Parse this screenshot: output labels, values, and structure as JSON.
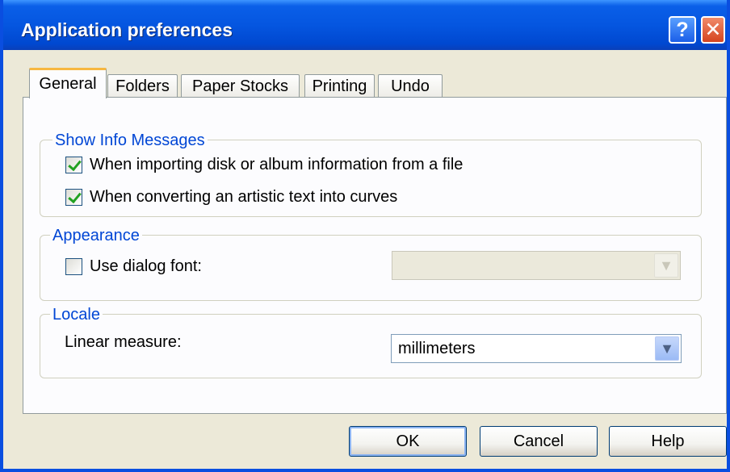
{
  "window": {
    "title": "Application preferences"
  },
  "title_buttons": {
    "help": "?",
    "close": "✕"
  },
  "tabs": [
    {
      "label": "General",
      "active": true
    },
    {
      "label": "Folders"
    },
    {
      "label": "Paper Stocks"
    },
    {
      "label": "Printing"
    },
    {
      "label": "Undo"
    }
  ],
  "show_info": {
    "title": "Show Info Messages",
    "import_label": "When importing disk or album information from a file",
    "import_checked": true,
    "convert_label": "When converting an artistic text into curves",
    "convert_checked": true
  },
  "appearance": {
    "title": "Appearance",
    "dialog_font_label": "Use dialog font:",
    "dialog_font_checked": false,
    "font_value": ""
  },
  "locale": {
    "title": "Locale",
    "linear_label": "Linear measure:",
    "linear_value": "millimeters"
  },
  "buttons": {
    "ok": "OK",
    "cancel": "Cancel",
    "help": "Help"
  },
  "icons": {
    "dropdown": "▼"
  }
}
